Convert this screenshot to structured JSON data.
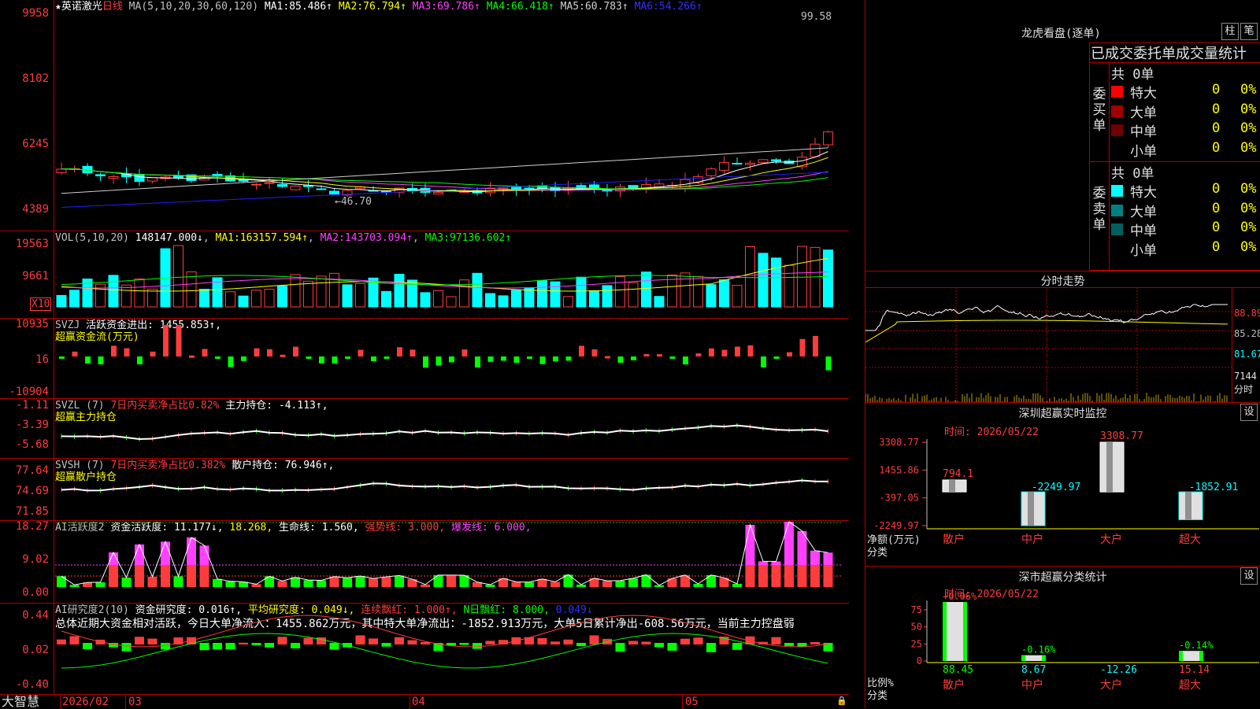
{
  "kline": {
    "title": "★英诺激光",
    "period": "日线",
    "ma_label": "MA(5,10,20,30,60,120)",
    "ma": [
      {
        "name": "MA1:",
        "value": "85.486↑",
        "color": "#ffffff"
      },
      {
        "name": "MA2:",
        "value": "76.794↑",
        "color": "#ffff00"
      },
      {
        "name": "MA3:",
        "value": "69.786↑",
        "color": "#ff40ff"
      },
      {
        "name": "MA4:",
        "value": "66.418↑",
        "color": "#00ff00"
      },
      {
        "name": "MA5:",
        "value": "60.783↑",
        "color": "#d0d0d0"
      },
      {
        "name": "MA6:",
        "value": "54.266↑",
        "color": "#2020ff"
      }
    ],
    "y_ticks": [
      "9958",
      "8102",
      "6245",
      "4389"
    ],
    "high_label": "99.58",
    "low_label": "46.70"
  },
  "vol": {
    "label": "VOL(5,10,20)",
    "value": "148147.000↓",
    "ma": [
      {
        "name": "MA1:",
        "value": "163157.594↑",
        "color": "#ffff00"
      },
      {
        "name": "MA2:",
        "value": "143703.094↑",
        "color": "#ff40ff"
      },
      {
        "name": "MA3:",
        "value": "97136.602↑",
        "color": "#00ff00"
      }
    ],
    "y_ticks": [
      "19563",
      "9661"
    ],
    "unit": "X10"
  },
  "svzj": {
    "label": "SVZJ",
    "line1": "活跃资金进出:",
    "value": "1455.853↑,",
    "line2": "超赢资金流(万元)",
    "y_ticks": [
      "10935",
      "16",
      "-10904"
    ]
  },
  "svzl": {
    "label": "SVZL (7)",
    "ratio": "7日内买卖净占比0.82%",
    "name": "主力持仓:",
    "value": "-4.113↑,",
    "line2": "超赢主力持仓",
    "y_ticks": [
      "-1.11",
      "-3.39",
      "-5.68"
    ]
  },
  "svsh": {
    "label": "SVSH (7)",
    "ratio": "7日内买卖净占比0.382%",
    "name": "散户持仓:",
    "value": "76.946↑,",
    "line2": "超赢散户持仓",
    "y_ticks": [
      "77.64",
      "74.69",
      "71.85"
    ]
  },
  "ai1": {
    "label": "AI活跃度2",
    "name": "资金活跃度:",
    "value": "11.177↓,",
    "v2": "18.268,",
    "life": "生命线: 1.560,",
    "strong": "强势线: 3.000,",
    "burst": "爆发线: 6.000,",
    "y_ticks": [
      "18.27",
      "9.02",
      "0.00"
    ]
  },
  "ai2": {
    "label": "AI研究度2(10)",
    "name": "资金研究度:",
    "value": "0.016↑,",
    "avg": "平均研究度: 0.049↓,",
    "cont": "连续飘红: 1.000↑,",
    "nday": "N日飘红: 8.000,",
    "last": "0.049↓",
    "summary": "总体近期大资金相对活跃，今日大单净流入：1455.862万元，其中特大单净流出：-1852.913万元，大单5日累计净出-608.56万元，当前主力控盘弱",
    "y_ticks": [
      "0.44",
      "0.02",
      "-0.40"
    ]
  },
  "xaxis": {
    "brand": "大智慧",
    "dates": [
      "2026/02",
      "03",
      "04",
      "05"
    ]
  },
  "lhb": {
    "title": "龙虎看盘(逐单)",
    "btn1": "柱",
    "btn2": "笔",
    "header": "已成交委托单成交量统计",
    "buy_group": "委买单",
    "sell_group": "委卖单",
    "buy_total": "共 0单",
    "sell_total": "共 0单",
    "buy_rows": [
      {
        "label": "特大",
        "value": "0",
        "pct": "0%",
        "color": "#ff0000"
      },
      {
        "label": "大单",
        "value": "0",
        "pct": "0%",
        "color": "#a00000"
      },
      {
        "label": "中单",
        "value": "0",
        "pct": "0%",
        "color": "#700000"
      },
      {
        "label": "小单",
        "value": "0",
        "pct": "0%",
        "color": ""
      }
    ],
    "sell_rows": [
      {
        "label": "特大",
        "value": "0",
        "pct": "0%",
        "color": "#00ffff"
      },
      {
        "label": "大单",
        "value": "0",
        "pct": "0%",
        "color": "#008080"
      },
      {
        "label": "中单",
        "value": "0",
        "pct": "0%",
        "color": "#006060"
      },
      {
        "label": "小单",
        "value": "0",
        "pct": "0%",
        "color": ""
      }
    ]
  },
  "fenshi": {
    "title": "分时走势",
    "y_ticks": [
      "88.89",
      "85.28",
      "81.67",
      "7144"
    ],
    "unit": "分时"
  },
  "monitor": {
    "title": "深圳超赢实时监控",
    "btn": "设",
    "time": "时间: 2026/05/22",
    "y_ticks": [
      "3308.77",
      "1455.86",
      "-397.05",
      "-2249.97"
    ],
    "ylabel1": "净额(万元)",
    "ylabel2": "分类",
    "bars": [
      {
        "cat": "散户",
        "value": 794.1,
        "label": "794.1",
        "lcolor": "#ff3c3c"
      },
      {
        "cat": "中户",
        "value": -2249.97,
        "label": "-2249.97",
        "lcolor": "#00ffff"
      },
      {
        "cat": "大户",
        "value": 3308.77,
        "label": "3308.77",
        "lcolor": "#ff3c3c"
      },
      {
        "cat": "超大",
        "value": -1852.91,
        "label": "-1852.91",
        "lcolor": "#00ffff"
      }
    ]
  },
  "classify": {
    "title": "深市超赢分类统计",
    "btn": "设",
    "time": "时间: 2026/05/22",
    "y_ticks": [
      "75",
      "50",
      "25",
      "0"
    ],
    "ylabel1": "比例%",
    "ylabel2": "分类",
    "bars": [
      {
        "cat": "散户",
        "value": 88.45,
        "label": "88.45",
        "delta": "+0.06%",
        "dcolor": "#ff3c3c",
        "vcolor": "#00ff00"
      },
      {
        "cat": "中户",
        "value": 8.67,
        "label": "8.67",
        "delta": "-0.16%",
        "dcolor": "#00ff00",
        "vcolor": "#00ffff"
      },
      {
        "cat": "大户",
        "value": -12.26,
        "label": "-12.26",
        "delta": "",
        "dcolor": "",
        "vcolor": "#00ffff"
      },
      {
        "cat": "超大",
        "value": 15.14,
        "label": "15.14",
        "delta": "-0.14%",
        "dcolor": "#00ff00",
        "vcolor": "#ff3c3c"
      }
    ]
  },
  "colors": {
    "up": "#ff3c3c",
    "down": "#00ffff",
    "grid": "#b00000"
  }
}
